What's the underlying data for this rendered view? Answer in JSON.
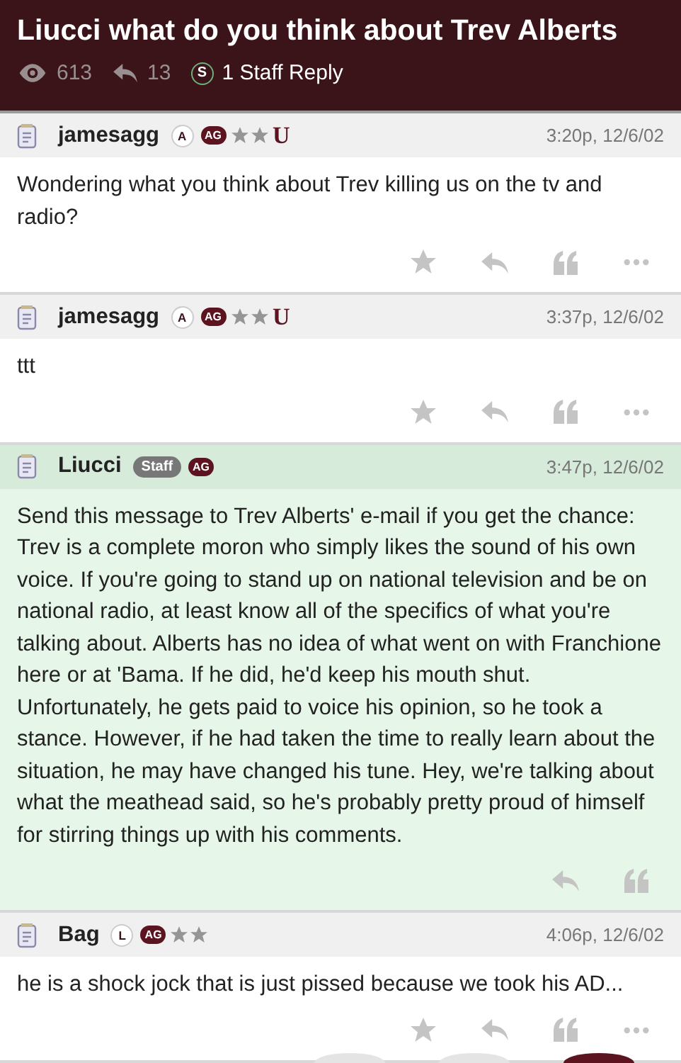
{
  "topic": {
    "title": "Liucci what do you think about Trev Alberts",
    "views": "613",
    "replies": "13",
    "staff_mark": "S",
    "staff_replies": "1 Staff Reply"
  },
  "posts": [
    {
      "author": "jamesagg",
      "staff": false,
      "time": "3:20p, 12/6/02",
      "badges": [
        {
          "kind": "circle",
          "text": "A"
        },
        {
          "kind": "pill",
          "text": "AG"
        },
        {
          "kind": "star"
        },
        {
          "kind": "star"
        },
        {
          "kind": "logo",
          "text": "U"
        }
      ],
      "text": "Wondering what you think about Trev killing us on the tv and radio?",
      "actions": [
        {
          "kind": "star"
        },
        {
          "kind": "reply"
        },
        {
          "kind": "quote"
        },
        {
          "kind": "more"
        }
      ]
    },
    {
      "author": "jamesagg",
      "staff": false,
      "time": "3:37p, 12/6/02",
      "badges": [
        {
          "kind": "circle",
          "text": "A"
        },
        {
          "kind": "pill",
          "text": "AG"
        },
        {
          "kind": "star"
        },
        {
          "kind": "star"
        },
        {
          "kind": "logo",
          "text": "U"
        }
      ],
      "text": "ttt",
      "actions": [
        {
          "kind": "star"
        },
        {
          "kind": "reply"
        },
        {
          "kind": "quote"
        },
        {
          "kind": "more"
        }
      ]
    },
    {
      "author": "Liucci",
      "staff": true,
      "time": "3:47p, 12/6/02",
      "badges": [
        {
          "kind": "tag",
          "text": "Staff"
        },
        {
          "kind": "pill",
          "text": "AG"
        }
      ],
      "text": "Send this message to Trev Alberts' e-mail if you get the chance: Trev is a complete moron who simply likes the sound of his own voice. If you're going to stand up on national television and be on national radio, at least know all of the specifics of what you're talking about. Alberts has no idea of what went on with Franchione here or at 'Bama. If he did, he'd keep his mouth shut. Unfortunately, he gets paid to voice his opinion, so he took a stance. However, if he had taken the time to really learn about the situation, he may have changed his tune. Hey, we're talking about what the meathead said, so he's probably pretty proud of himself for stirring things up with his comments.",
      "actions": [
        {
          "kind": "reply"
        },
        {
          "kind": "quote"
        }
      ]
    },
    {
      "author": "Bag",
      "staff": false,
      "time": "4:06p, 12/6/02",
      "badges": [
        {
          "kind": "circle",
          "text": "L"
        },
        {
          "kind": "pill",
          "text": "AG"
        },
        {
          "kind": "star"
        },
        {
          "kind": "star"
        }
      ],
      "text": "he is a shock jock that is just pissed because we took his AD...",
      "actions": [
        {
          "kind": "star"
        },
        {
          "kind": "reply"
        },
        {
          "kind": "quote"
        },
        {
          "kind": "more"
        }
      ]
    }
  ],
  "floating_buttons": [
    {
      "kind": "plain"
    },
    {
      "kind": "plain"
    },
    {
      "kind": "primary"
    }
  ]
}
